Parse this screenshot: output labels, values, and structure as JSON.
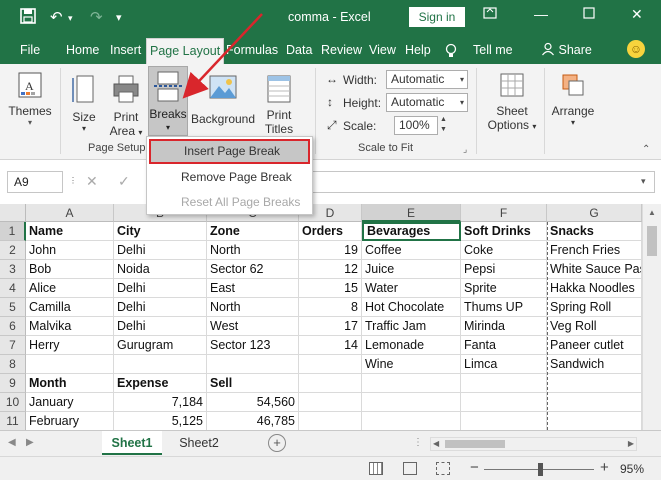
{
  "window": {
    "title": "comma",
    "app": "Excel",
    "sign_in": "Sign in",
    "title_sep": " - "
  },
  "menu": {
    "tabs": [
      "File",
      "Home",
      "Insert",
      "Page Layout",
      "Formulas",
      "Data",
      "Review",
      "View",
      "Help",
      "Tell me",
      "Share"
    ]
  },
  "ribbon": {
    "themes": "Themes",
    "size": "Size",
    "print_area_1": "Print",
    "print_area_2": "Area",
    "breaks": "Breaks",
    "background": "Background",
    "print_titles_1": "Print",
    "print_titles_2": "Titles",
    "page_setup": "Page Setup",
    "width_label": "Width:",
    "width_value": "Automatic",
    "height_label": "Height:",
    "height_value": "Automatic",
    "scale_label": "Scale:",
    "scale_value": "100%",
    "scale_to_fit": "Scale to Fit",
    "sheet_options_1": "Sheet",
    "sheet_options_2": "Options",
    "arrange": "Arrange"
  },
  "dropdown": {
    "items": [
      "Insert Page Break",
      "Remove Page Break",
      "Reset All Page Breaks"
    ]
  },
  "formula_bar": {
    "name_box": "A9",
    "fx": "fx"
  },
  "grid": {
    "columns": [
      "A",
      "B",
      "C",
      "D",
      "E",
      "F",
      "G"
    ],
    "rows": [
      "1",
      "2",
      "3",
      "4",
      "5",
      "6",
      "7",
      "8",
      "9",
      "10",
      "11"
    ],
    "data": [
      [
        "Name",
        "City",
        "Zone",
        "Orders",
        "Bevarages",
        "Soft Drinks",
        "Snacks"
      ],
      [
        "John",
        "Delhi",
        "North",
        "19",
        "Coffee",
        "Coke",
        "French Fries"
      ],
      [
        "Bob",
        "Noida",
        "Sector 62",
        "12",
        "Juice",
        "Pepsi",
        "White Sauce Pasta"
      ],
      [
        "Alice",
        "Delhi",
        "East",
        "15",
        "Water",
        "Sprite",
        "Hakka Noodles"
      ],
      [
        "Camilla",
        "Delhi",
        "North",
        "8",
        "Hot Chocolate",
        "Thums UP",
        "Spring Roll"
      ],
      [
        "Malvika",
        "Delhi",
        "West",
        "17",
        "Traffic Jam",
        "Mirinda",
        "Veg Roll"
      ],
      [
        "Herry",
        "Gurugram",
        "Sector 123",
        "14",
        "Lemonade",
        "Fanta",
        "Paneer cutlet"
      ],
      [
        "",
        "",
        "",
        "",
        "Wine",
        "Limca",
        "Sandwich"
      ],
      [
        "Month",
        "Expense",
        "Sell",
        "",
        "",
        "",
        ""
      ],
      [
        "January",
        "7,184",
        "54,560",
        "",
        "",
        "",
        ""
      ],
      [
        "February",
        "5,125",
        "46,785",
        "",
        "",
        "",
        ""
      ]
    ]
  },
  "sheets": [
    "Sheet1",
    "Sheet2"
  ],
  "status": {
    "zoom": "95%"
  },
  "colors": {
    "excel_green": "#217346",
    "highlight_red": "#d9262c"
  }
}
